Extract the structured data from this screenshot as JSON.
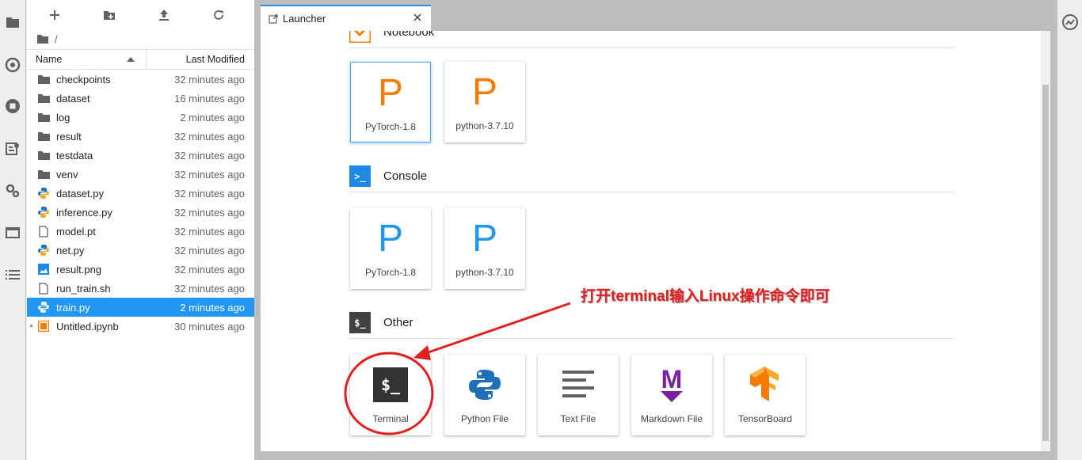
{
  "filebrowser": {
    "breadcrumb": "/",
    "columns": {
      "name": "Name",
      "modified": "Last Modified"
    },
    "files": [
      {
        "name": "checkpoints",
        "modified": "32 minutes ago",
        "kind": "folder"
      },
      {
        "name": "dataset",
        "modified": "16 minutes ago",
        "kind": "folder"
      },
      {
        "name": "log",
        "modified": "2 minutes ago",
        "kind": "folder"
      },
      {
        "name": "result",
        "modified": "32 minutes ago",
        "kind": "folder"
      },
      {
        "name": "testdata",
        "modified": "32 minutes ago",
        "kind": "folder"
      },
      {
        "name": "venv",
        "modified": "32 minutes ago",
        "kind": "folder"
      },
      {
        "name": "dataset.py",
        "modified": "32 minutes ago",
        "kind": "python"
      },
      {
        "name": "inference.py",
        "modified": "32 minutes ago",
        "kind": "python"
      },
      {
        "name": "model.pt",
        "modified": "32 minutes ago",
        "kind": "file"
      },
      {
        "name": "net.py",
        "modified": "32 minutes ago",
        "kind": "python"
      },
      {
        "name": "result.png",
        "modified": "32 minutes ago",
        "kind": "image"
      },
      {
        "name": "run_train.sh",
        "modified": "32 minutes ago",
        "kind": "file"
      },
      {
        "name": "train.py",
        "modified": "2 minutes ago",
        "kind": "python",
        "selected": true
      },
      {
        "name": "Untitled.ipynb",
        "modified": "30 minutes ago",
        "kind": "notebook",
        "running": true
      }
    ]
  },
  "tab": {
    "title": "Launcher"
  },
  "launcher": {
    "notebook_section": "Notebook",
    "notebook_cards": [
      {
        "label": "PyTorch-1.8",
        "glyph": "P"
      },
      {
        "label": "python-3.7.10",
        "glyph": "P"
      }
    ],
    "console_section": "Console",
    "console_cards": [
      {
        "label": "PyTorch-1.8",
        "glyph": "P"
      },
      {
        "label": "python-3.7.10",
        "glyph": "P"
      }
    ],
    "other_section": "Other",
    "other_cards": [
      {
        "label": "Terminal",
        "glyph": "$_"
      },
      {
        "label": "Python File",
        "glyph": "python-logo"
      },
      {
        "label": "Text File",
        "glyph": "text-lines"
      },
      {
        "label": "Markdown File",
        "glyph": "M"
      },
      {
        "label": "TensorBoard",
        "glyph": "tensorflow-logo"
      }
    ],
    "section_icon_text": {
      "console": ">_",
      "other": "$_"
    }
  },
  "annotation": {
    "text": "打开terminal输入Linux操作命令即可"
  },
  "colors": {
    "accent": "#2196f3",
    "notebook_glyph": "#f57c00",
    "console_glyph": "#2196f3",
    "annotation_red": "#e02020",
    "markdown_purple": "#7b1fa2"
  }
}
